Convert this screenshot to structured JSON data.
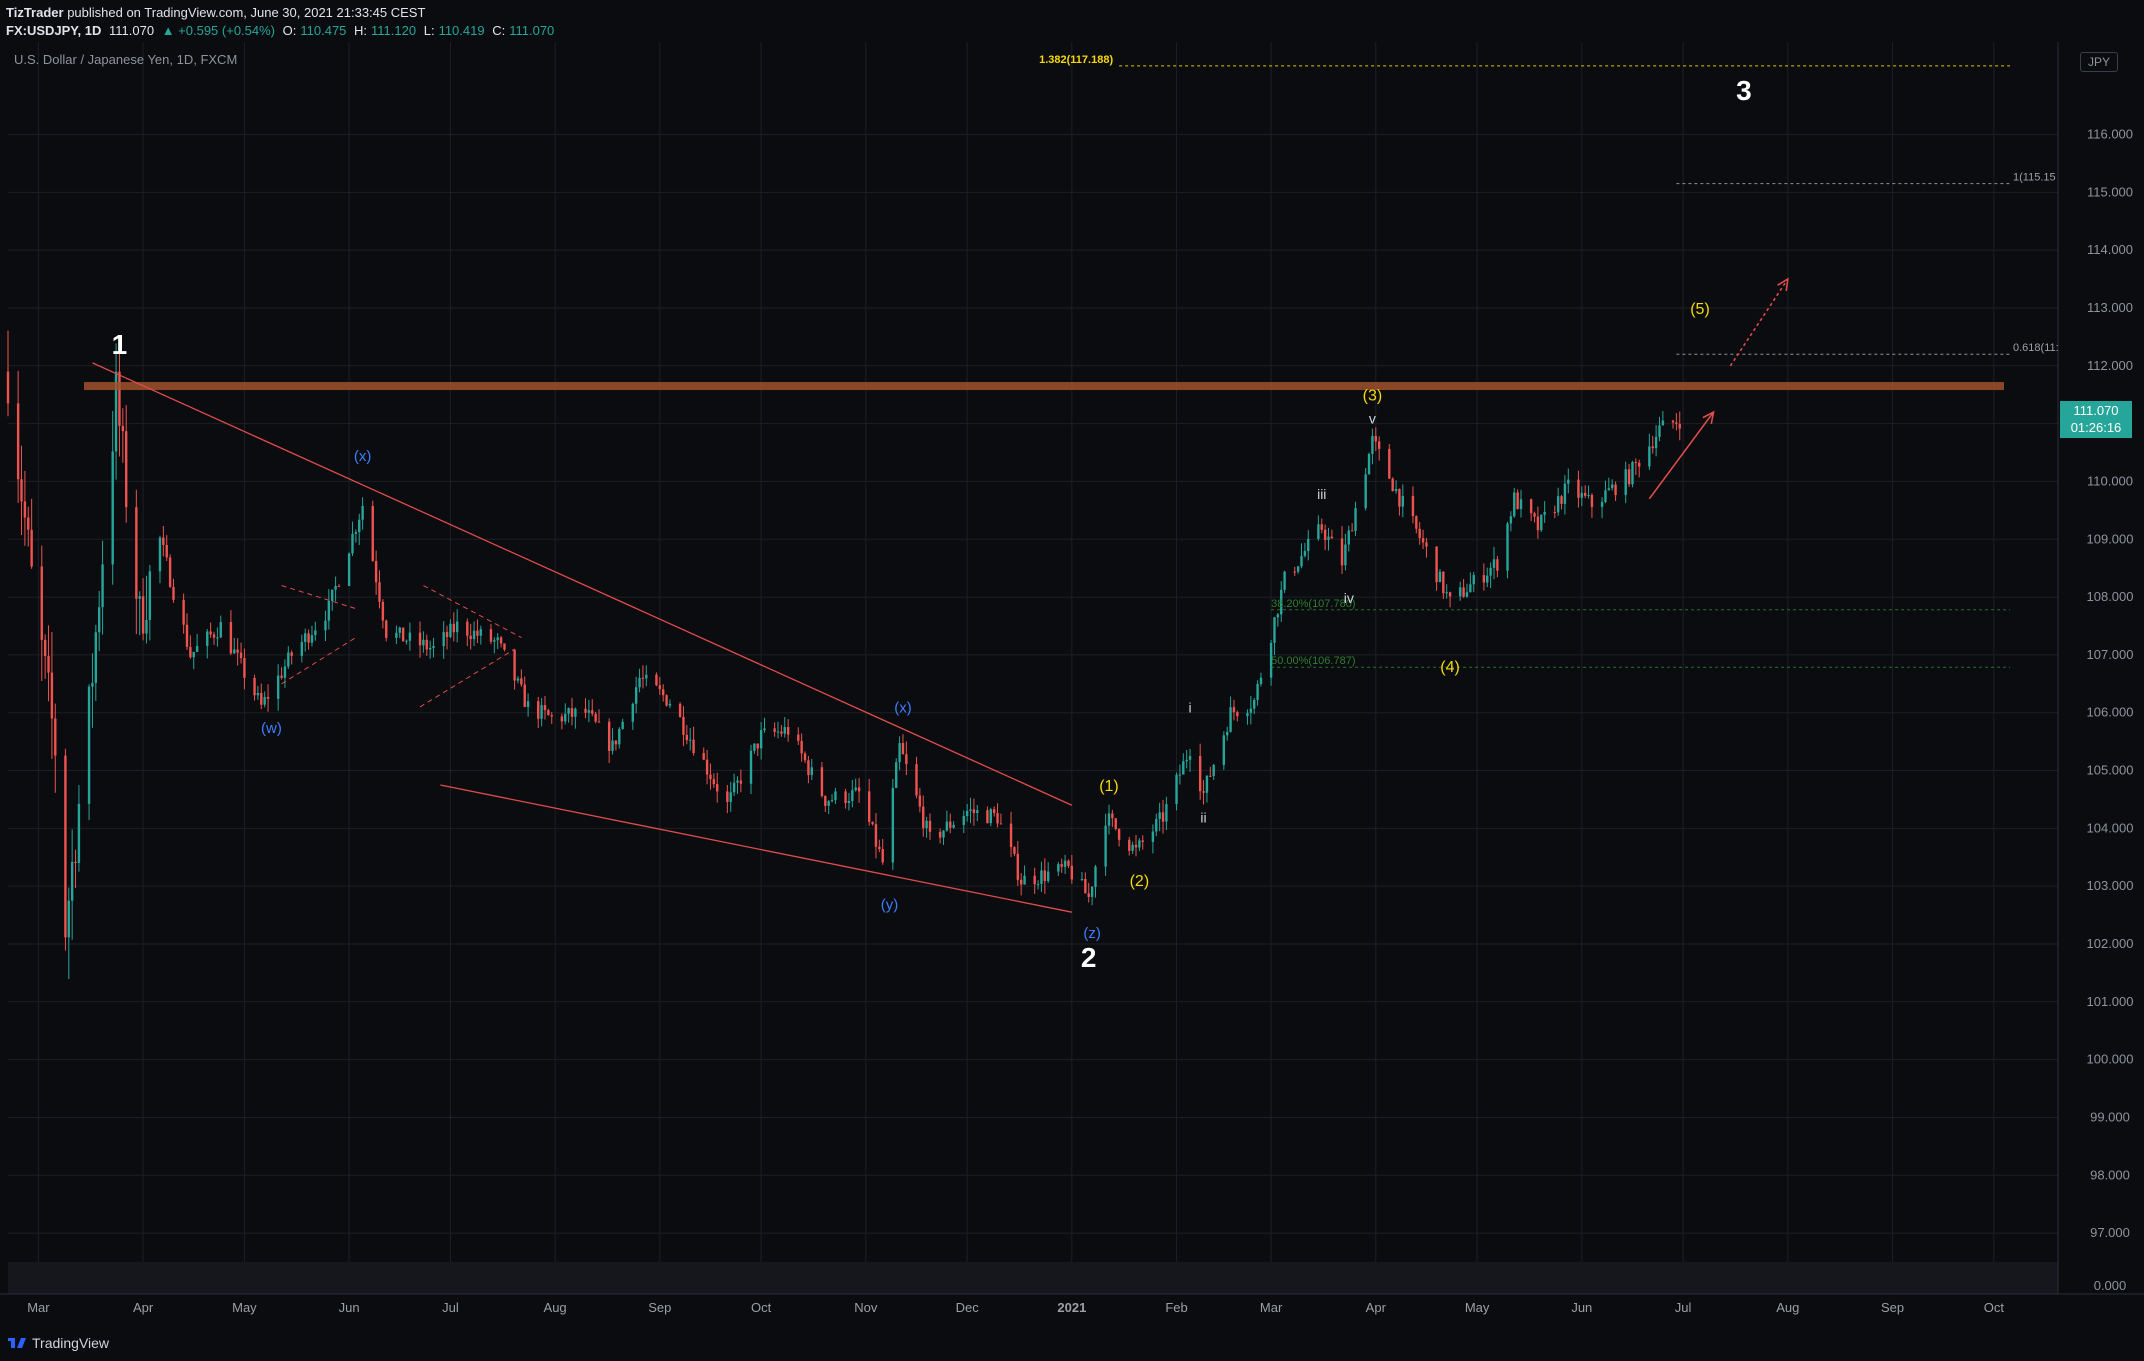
{
  "header": {
    "author": "TizTrader",
    "published": "published on TradingView.com, June 30, 2021 21:33:45 CEST",
    "symbol_tf": "FX:USDJPY, 1D",
    "last": "111.070",
    "change": "▲ +0.595 (+0.54%)",
    "o_label": "O:",
    "o_val": "110.475",
    "h_label": "H:",
    "h_val": "111.120",
    "l_label": "L:",
    "l_val": "110.419",
    "c_label": "C:",
    "c_val": "111.070"
  },
  "symbol_title": "U.S. Dollar / Japanese Yen, 1D, FXCM",
  "currency_badge": "JPY",
  "price_tag": {
    "price": "111.070",
    "countdown": "01:26:16"
  },
  "footer": {
    "brand": "TradingView"
  },
  "colors": {
    "background": "#0b0c0f",
    "up": "#26a69a",
    "down": "#ef5350",
    "trendline": "#e04c4c",
    "resistance": "#a0522d",
    "yellow": "#f5d90a",
    "blue": "#3d7dff"
  },
  "chart_data": {
    "type": "candlestick",
    "ylim": [
      96.5,
      117.6
    ],
    "y_ticks": [
      "97.000",
      "98.000",
      "99.000",
      "100.000",
      "101.000",
      "102.000",
      "103.000",
      "104.000",
      "105.000",
      "106.000",
      "107.000",
      "108.000",
      "109.000",
      "110.000",
      "111.000",
      "112.000",
      "113.000",
      "114.000",
      "115.000",
      "116.000"
    ],
    "volume_axis_label": "0.000",
    "x_ticks": [
      "Mar",
      "Apr",
      "May",
      "Jun",
      "Jul",
      "Aug",
      "Sep",
      "Oct",
      "Nov",
      "Dec",
      "2021",
      "Feb",
      "Mar",
      "Apr",
      "May",
      "Jun",
      "Jul",
      "Aug",
      "Sep",
      "Oct"
    ],
    "x_range": [
      "2020-02-21",
      "2021-10-20"
    ],
    "x_tick_dates": [
      "2020-03-01",
      "2020-04-01",
      "2020-05-01",
      "2020-06-01",
      "2020-07-01",
      "2020-08-01",
      "2020-09-01",
      "2020-10-01",
      "2020-11-01",
      "2020-12-01",
      "2021-01-01",
      "2021-02-01",
      "2021-03-01",
      "2021-04-01",
      "2021-05-01",
      "2021-06-01",
      "2021-07-01",
      "2021-08-01",
      "2021-09-01",
      "2021-10-01"
    ],
    "price_path": [
      [
        "2020-02-21",
        111.9
      ],
      [
        "2020-02-28",
        108.3
      ],
      [
        "2020-03-06",
        105.4
      ],
      [
        "2020-03-09",
        102.3
      ],
      [
        "2020-03-16",
        106.0
      ],
      [
        "2020-03-24",
        111.5
      ],
      [
        "2020-03-31",
        107.6
      ],
      [
        "2020-04-06",
        109.0
      ],
      [
        "2020-04-15",
        107.0
      ],
      [
        "2020-04-24",
        107.5
      ],
      [
        "2020-05-06",
        106.1
      ],
      [
        "2020-05-15",
        107.0
      ],
      [
        "2020-05-26",
        107.8
      ],
      [
        "2020-06-05",
        109.6
      ],
      [
        "2020-06-12",
        107.4
      ],
      [
        "2020-06-26",
        107.1
      ],
      [
        "2020-07-03",
        107.5
      ],
      [
        "2020-07-15",
        107.2
      ],
      [
        "2020-07-24",
        106.1
      ],
      [
        "2020-07-31",
        105.9
      ],
      [
        "2020-08-10",
        106.0
      ],
      [
        "2020-08-18",
        105.4
      ],
      [
        "2020-08-26",
        106.6
      ],
      [
        "2020-09-04",
        106.2
      ],
      [
        "2020-09-21",
        104.4
      ],
      [
        "2020-10-01",
        105.6
      ],
      [
        "2020-10-09",
        105.7
      ],
      [
        "2020-10-20",
        104.5
      ],
      [
        "2020-10-30",
        104.6
      ],
      [
        "2020-11-06",
        103.4
      ],
      [
        "2020-11-11",
        105.4
      ],
      [
        "2020-11-20",
        103.8
      ],
      [
        "2020-12-01",
        104.3
      ],
      [
        "2020-12-10",
        104.2
      ],
      [
        "2020-12-17",
        103.1
      ],
      [
        "2020-12-31",
        103.3
      ],
      [
        "2021-01-06",
        102.8
      ],
      [
        "2021-01-11",
        104.2
      ],
      [
        "2021-01-20",
        103.6
      ],
      [
        "2021-01-28",
        104.2
      ],
      [
        "2021-02-05",
        105.4
      ],
      [
        "2021-02-09",
        104.6
      ],
      [
        "2021-02-17",
        106.0
      ],
      [
        "2021-02-24",
        106.2
      ],
      [
        "2021-03-05",
        108.3
      ],
      [
        "2021-03-16",
        109.2
      ],
      [
        "2021-03-22",
        108.6
      ],
      [
        "2021-03-31",
        110.7
      ],
      [
        "2021-04-09",
        109.6
      ],
      [
        "2021-04-16",
        108.8
      ],
      [
        "2021-04-23",
        107.9
      ],
      [
        "2021-05-07",
        108.6
      ],
      [
        "2021-05-12",
        109.7
      ],
      [
        "2021-05-19",
        109.2
      ],
      [
        "2021-05-28",
        109.9
      ],
      [
        "2021-06-04",
        109.6
      ],
      [
        "2021-06-15",
        110.1
      ],
      [
        "2021-06-24",
        110.9
      ],
      [
        "2021-06-30",
        111.07
      ]
    ],
    "levels": [
      {
        "label": "1.382(117.188)",
        "value": 117.188,
        "color": "#f5d90a",
        "from": "2021-01-15"
      },
      {
        "label": "1(115.15",
        "value": 115.15,
        "color": "#9aa0a6",
        "from": "2021-06-29"
      },
      {
        "label": "0.618(11:",
        "value": 112.2,
        "color": "#9aa0a6",
        "from": "2021-06-29"
      },
      {
        "label": "38.20%(107.780)",
        "value": 107.78,
        "color": "#2e7d32",
        "from": "2021-03-01"
      },
      {
        "label": "50.00%(106.787)",
        "value": 106.787,
        "color": "#2e7d32",
        "from": "2021-03-01"
      }
    ],
    "resistance": 111.65,
    "wave_labels": [
      {
        "text": "1",
        "date": "2020-03-25",
        "price": 112.2,
        "color": "#ffffff",
        "size": 28,
        "bold": true
      },
      {
        "text": "2",
        "date": "2021-01-06",
        "price": 101.6,
        "color": "#ffffff",
        "size": 28,
        "bold": true
      },
      {
        "text": "3",
        "date": "2021-07-19",
        "price": 116.6,
        "color": "#ffffff",
        "size": 28,
        "bold": true
      },
      {
        "text": "(x)",
        "date": "2020-06-05",
        "price": 110.35,
        "color": "#3d7dff",
        "size": 15
      },
      {
        "text": "(w)",
        "date": "2020-05-09",
        "price": 105.65,
        "color": "#3d7dff",
        "size": 15
      },
      {
        "text": "(x)",
        "date": "2020-11-12",
        "price": 106.0,
        "color": "#3d7dff",
        "size": 15
      },
      {
        "text": "(y)",
        "date": "2020-11-08",
        "price": 102.6,
        "color": "#3d7dff",
        "size": 15
      },
      {
        "text": "(z)",
        "date": "2021-01-07",
        "price": 102.1,
        "color": "#3d7dff",
        "size": 15
      },
      {
        "text": "(1)",
        "date": "2021-01-12",
        "price": 104.65,
        "color": "#f5d90a",
        "size": 16
      },
      {
        "text": "(2)",
        "date": "2021-01-21",
        "price": 103.0,
        "color": "#f5d90a",
        "size": 16
      },
      {
        "text": "(3)",
        "date": "2021-03-31",
        "price": 111.4,
        "color": "#f5d90a",
        "size": 16
      },
      {
        "text": "(4)",
        "date": "2021-04-23",
        "price": 106.7,
        "color": "#f5d90a",
        "size": 16
      },
      {
        "text": "(5)",
        "date": "2021-07-06",
        "price": 112.9,
        "color": "#f5d90a",
        "size": 16
      },
      {
        "text": "i",
        "date": "2021-02-05",
        "price": 106.0,
        "color": "#d1d4dc",
        "size": 14
      },
      {
        "text": "ii",
        "date": "2021-02-09",
        "price": 104.1,
        "color": "#d1d4dc",
        "size": 14
      },
      {
        "text": "iii",
        "date": "2021-03-16",
        "price": 109.7,
        "color": "#d1d4dc",
        "size": 14
      },
      {
        "text": "iv",
        "date": "2021-03-24",
        "price": 107.9,
        "color": "#d1d4dc",
        "size": 14
      },
      {
        "text": "v",
        "date": "2021-03-31",
        "price": 111.0,
        "color": "#d1d4dc",
        "size": 14
      }
    ]
  }
}
